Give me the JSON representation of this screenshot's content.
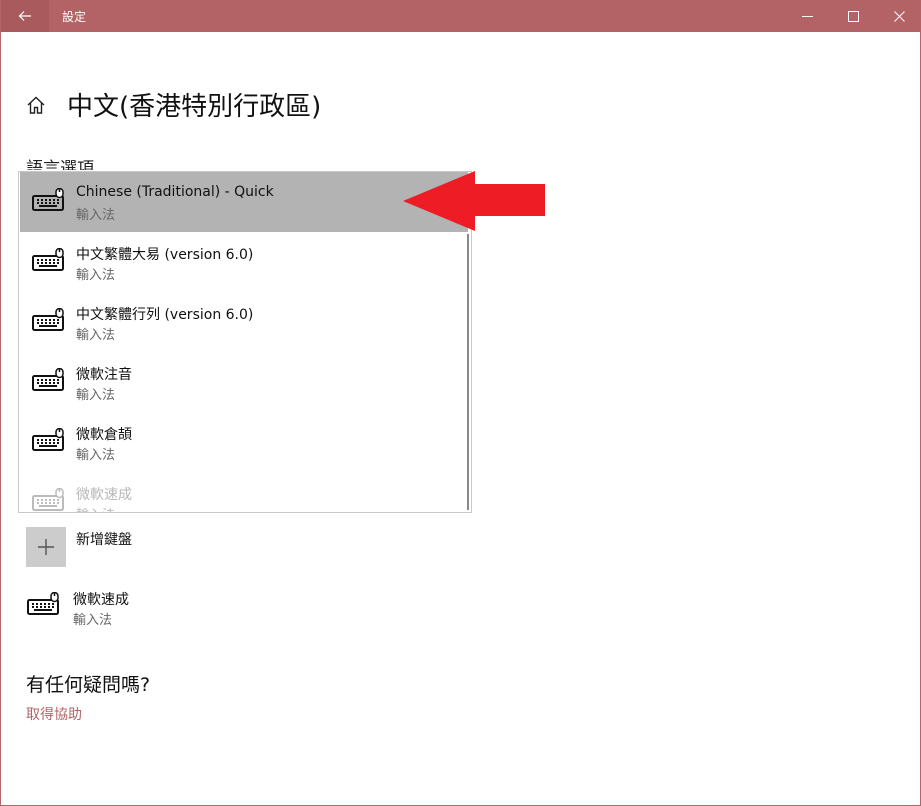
{
  "window": {
    "title": "設定"
  },
  "page": {
    "title": "中文(香港特別行政區)",
    "section_label": "語言選項"
  },
  "dropdown": {
    "items": [
      {
        "name": "Chinese (Traditional) - Quick",
        "subtitle": "輸入法"
      },
      {
        "name": "中文繁體大易 (version 6.0)",
        "subtitle": "輸入法"
      },
      {
        "name": "中文繁體行列 (version 6.0)",
        "subtitle": "輸入法"
      },
      {
        "name": "微軟注音",
        "subtitle": "輸入法"
      },
      {
        "name": "微軟倉頡",
        "subtitle": "輸入法"
      },
      {
        "name": "微軟速成",
        "subtitle": "輸入法"
      }
    ]
  },
  "add_keyboard": {
    "label": "新增鍵盤"
  },
  "installed_keyboard": {
    "name": "微軟速成",
    "subtitle": "輸入法"
  },
  "help": {
    "title": "有任何疑問嗎?",
    "link": "取得協助"
  },
  "colors": {
    "titlebar": "#b36366",
    "selected_item": "#b3b3b3",
    "annotation_arrow": "#ee1c25",
    "link": "#b36366"
  },
  "icons": [
    "back-arrow-icon",
    "minimize-icon",
    "maximize-icon",
    "close-icon",
    "home-icon",
    "keyboard-icon",
    "plus-icon"
  ]
}
